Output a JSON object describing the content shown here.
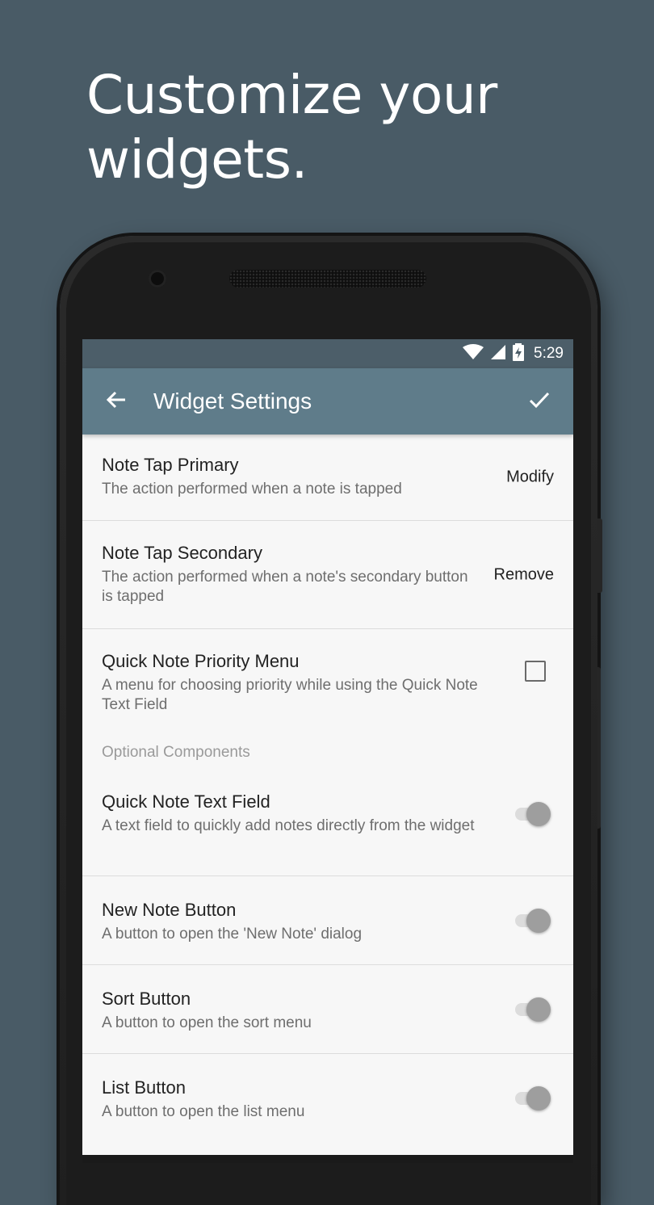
{
  "headline": {
    "line1": "Customize your",
    "line2": "widgets."
  },
  "status_bar": {
    "time": "5:29",
    "icons": [
      "wifi-icon",
      "cell-signal-icon",
      "battery-charging-icon"
    ]
  },
  "app_bar": {
    "title": "Widget Settings",
    "back_icon": "arrow-back-icon",
    "confirm_icon": "check-icon"
  },
  "settings": {
    "note_tap_primary": {
      "title": "Note Tap Primary",
      "subtitle": "The action performed when a note is tapped",
      "action": "Modify"
    },
    "note_tap_secondary": {
      "title": "Note Tap Secondary",
      "subtitle": "The action performed when a note's secondary button is tapped",
      "action": "Remove"
    },
    "quick_note_priority_menu": {
      "title": "Quick Note Priority Menu",
      "subtitle": "A menu for choosing priority while using the Quick Note Text Field",
      "checked": false
    }
  },
  "optional_components": {
    "header": "Optional Components",
    "items": [
      {
        "title": "Quick Note Text Field",
        "subtitle": "A text field to quickly add notes directly from the widget",
        "enabled": true
      },
      {
        "title": "New Note Button",
        "subtitle": "A button to open the 'New Note' dialog",
        "enabled": true
      },
      {
        "title": "Sort Button",
        "subtitle": "A button to open the sort menu",
        "enabled": true
      },
      {
        "title": "List Button",
        "subtitle": "A button to open the list menu",
        "enabled": true
      }
    ]
  },
  "colors": {
    "background": "#495b66",
    "status_bar": "#4c5e69",
    "app_bar": "#5f7c8a",
    "screen": "#f7f7f7",
    "toggle_thumb": "#9e9e9e"
  }
}
